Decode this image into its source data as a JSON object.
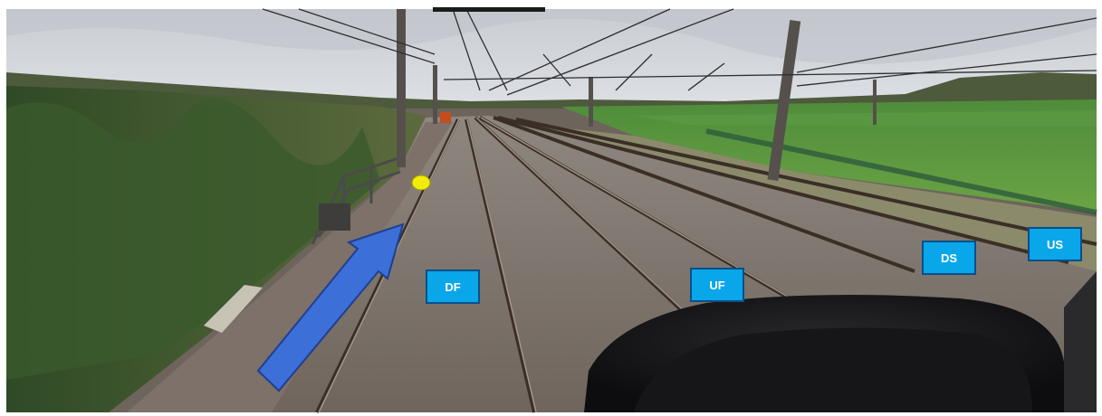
{
  "track_labels": {
    "df": "DF",
    "uf": "UF",
    "ds": "DS",
    "us": "US"
  },
  "colors": {
    "label_fill": "#0aa6ea",
    "arrow_fill": "#3d6fd8",
    "marker_fill": "#f2ec0a"
  }
}
